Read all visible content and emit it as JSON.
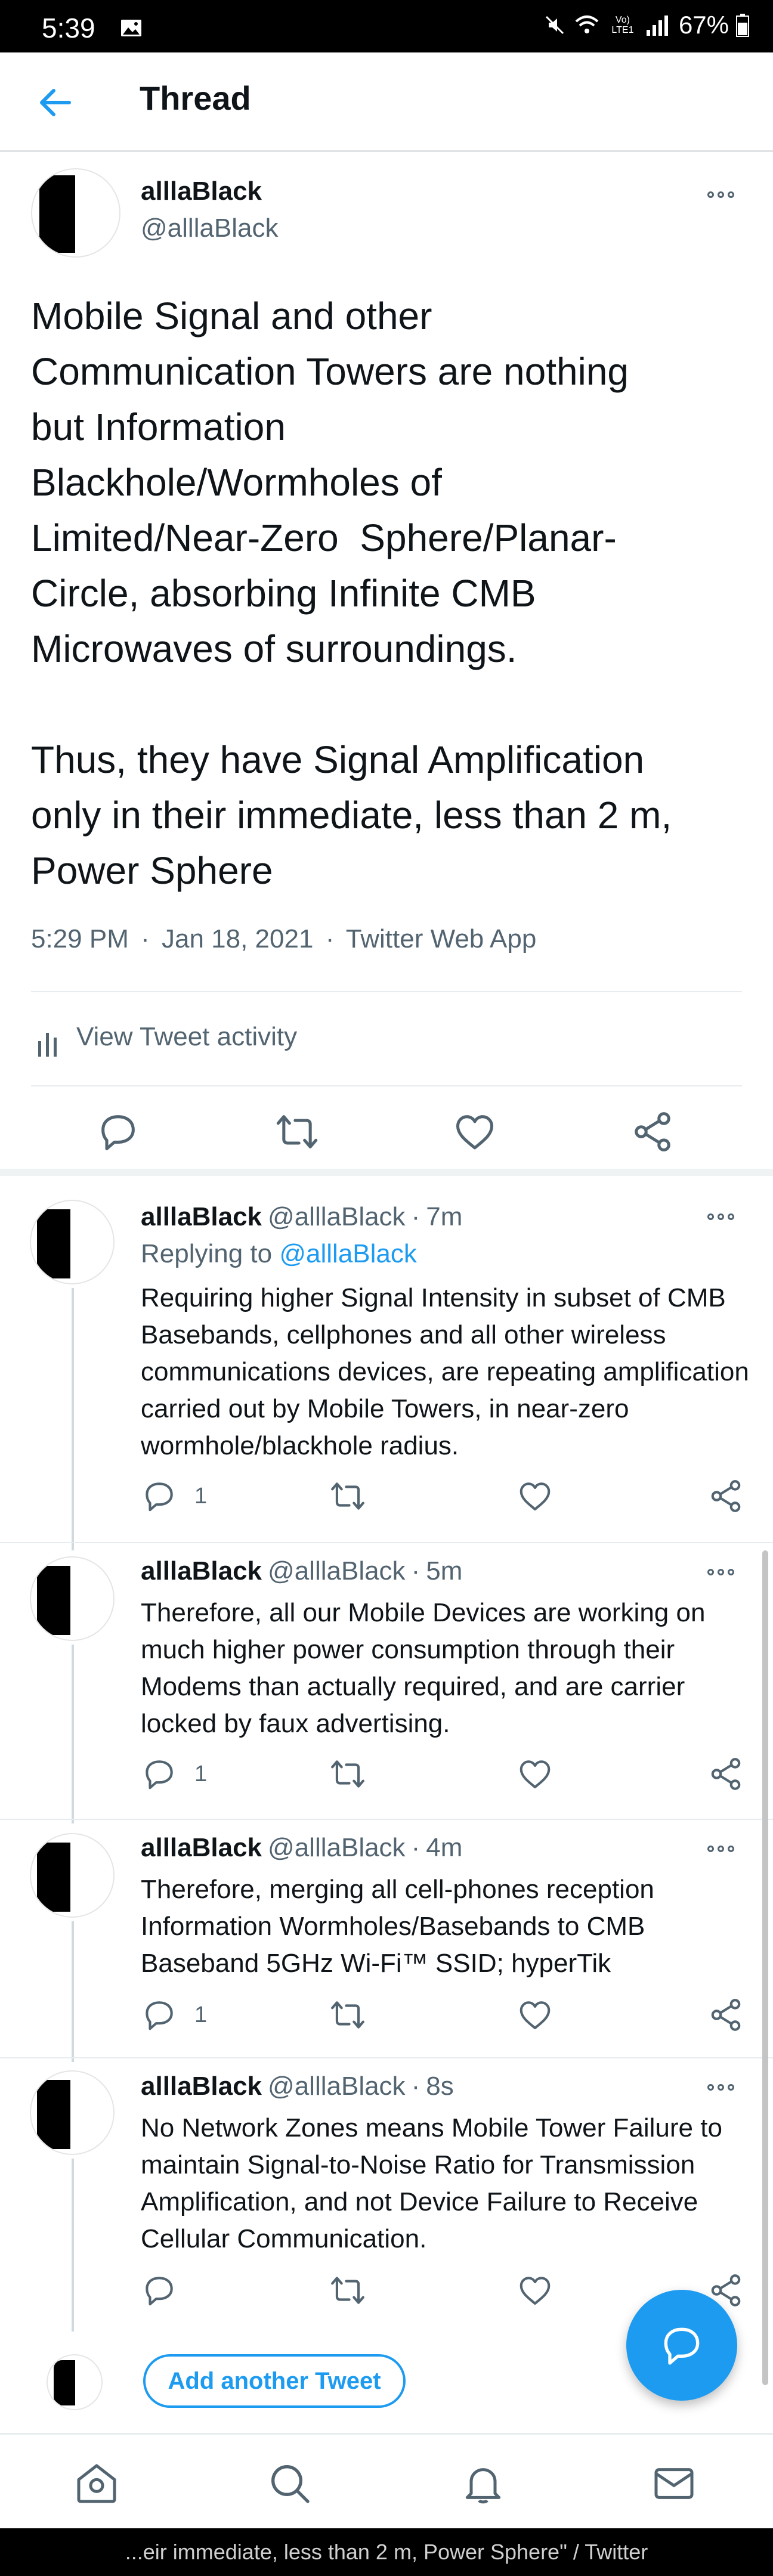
{
  "status_bar": {
    "time": "5:39",
    "battery": "67%",
    "lte_label": "Vo) LTE1"
  },
  "header": {
    "title": "Thread",
    "back_icon": "arrow-left-icon"
  },
  "main_tweet": {
    "name": "alllaBlack",
    "handle": "@alllaBlack",
    "text": "Mobile Signal and other\nCommunication Towers are nothing\nbut Information\nBlackhole/Wormholes of\nLimited/Near-Zero  Sphere/Planar-\nCircle, absorbing Infinite CMB\nMicrowaves of surroundings.\n\nThus, they have Signal Amplification\nonly in their immediate, less than 2 m,\nPower Sphere",
    "time": "5:29 PM",
    "date": "Jan 18, 2021",
    "source": "Twitter Web App",
    "activity_label": "View Tweet activity"
  },
  "replies": [
    {
      "name": "alllaBlack",
      "handle": "@alllaBlack",
      "age": "7m",
      "replying_prefix": "Replying to ",
      "replying_to": "@alllaBlack",
      "text": "Requiring higher Signal Intensity in subset of CMB Basebands, cellphones and all other wireless communications devices, are repeating amplification carried out by Mobile Towers, in near-zero wormhole/blackhole radius.",
      "reply_count": "1"
    },
    {
      "name": "alllaBlack",
      "handle": "@alllaBlack",
      "age": "5m",
      "text": "Therefore, all our Mobile Devices are working on much higher power consumption through their Modems than actually required, and are carrier locked by faux advertising.",
      "reply_count": "1"
    },
    {
      "name": "alllaBlack",
      "handle": "@alllaBlack",
      "age": "4m",
      "text": "Therefore, merging all cell-phones reception Information Wormholes/Basebands to CMB Baseband 5GHz Wi-Fi™ SSID; hyperTik",
      "reply_count": "1"
    },
    {
      "name": "alllaBlack",
      "handle": "@alllaBlack",
      "age": "8s",
      "text": "No Network Zones means Mobile Tower Failure to maintain Signal-to-Noise Ratio for Transmission Amplification, and not Device Failure to Receive Cellular Communication.",
      "reply_count": ""
    }
  ],
  "add_tweet_label": "Add another Tweet",
  "bottom_nav": [
    "home-icon",
    "search-icon",
    "notifications-icon",
    "messages-icon"
  ],
  "caption": "...eir immediate, less than 2 m, Power Sphere\" / Twitter",
  "colors": {
    "accent": "#1d9bf0",
    "text": "#0f1419",
    "secondary": "#536471"
  }
}
